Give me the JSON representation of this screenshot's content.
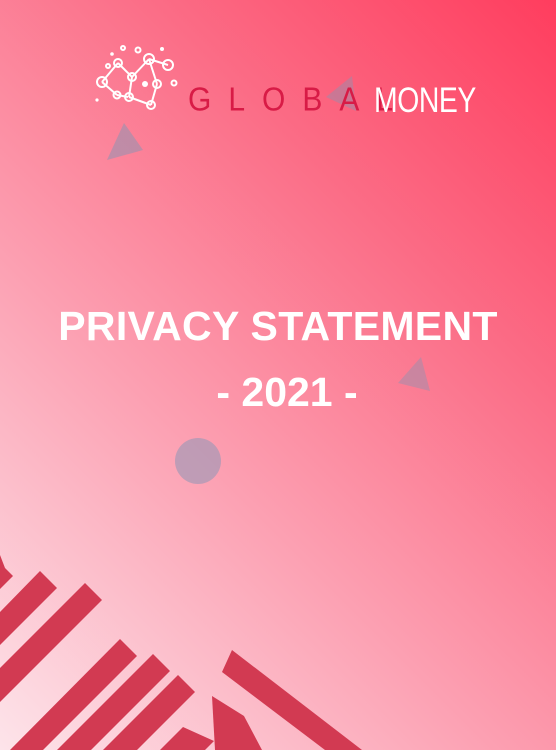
{
  "logo": {
    "word1": "GLOBAL",
    "word2": "MONEY",
    "icon": "network-nodes-icon"
  },
  "cover": {
    "title": "PRIVACY STATEMENT",
    "year": "- 2021 -"
  },
  "colors": {
    "brand_red": "#d81b46",
    "stripe_red": "#d23a52",
    "gradient_top_right": "#ff3d5e",
    "gradient_bottom_left": "#fde4ea",
    "shape_blue_grey": "#9f8fb0"
  }
}
